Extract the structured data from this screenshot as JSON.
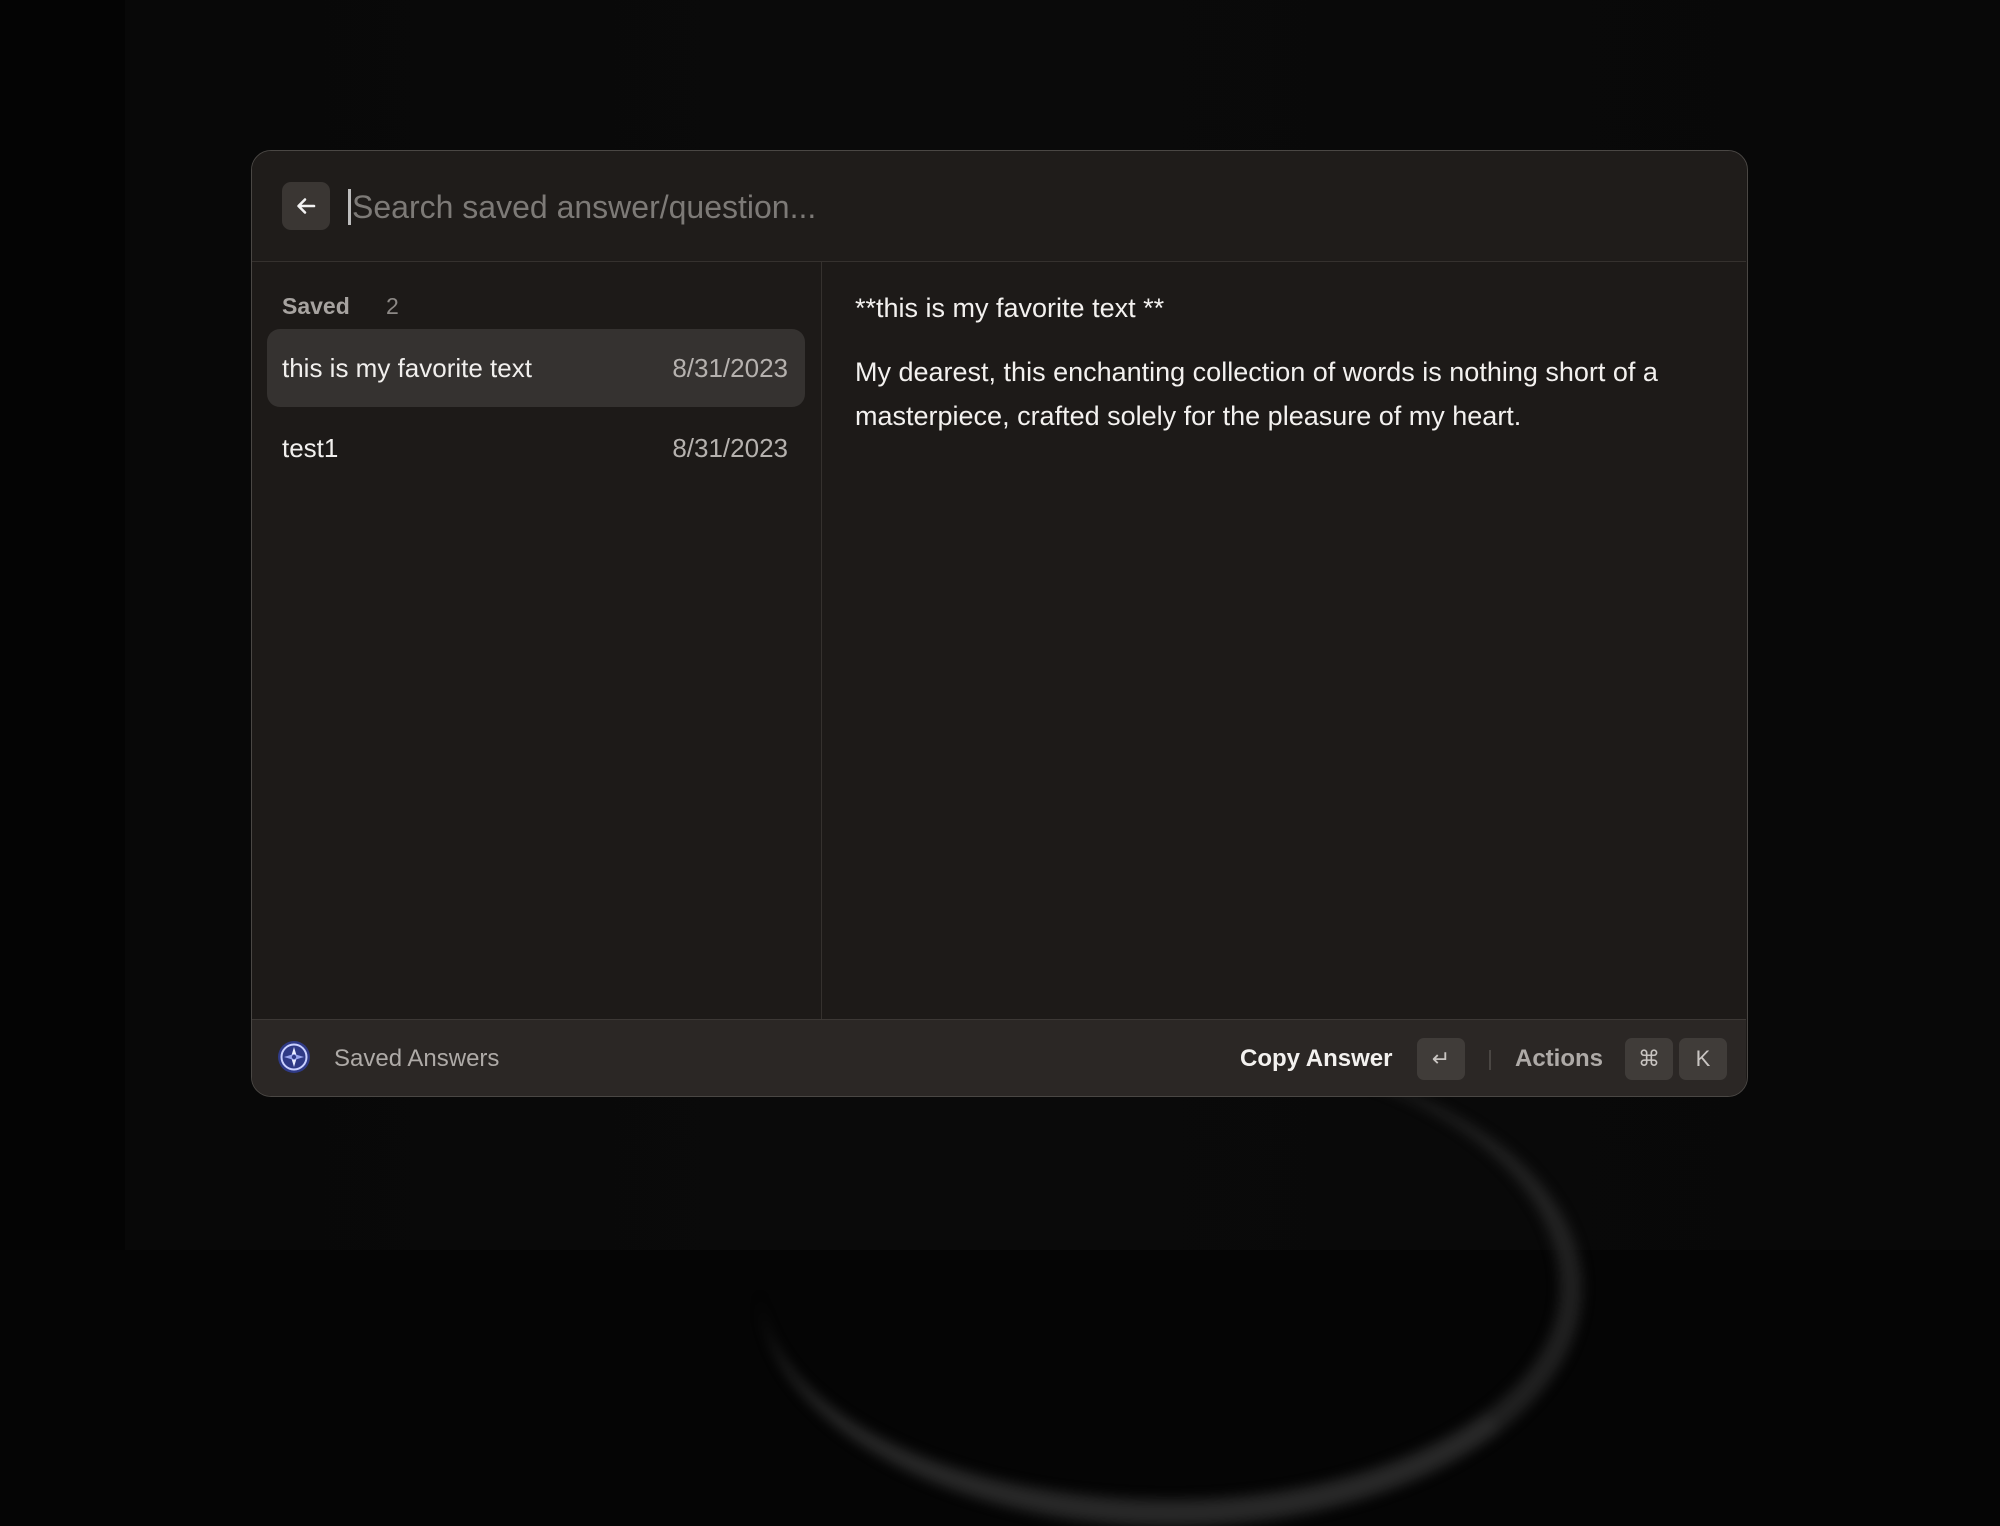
{
  "search": {
    "placeholder": "Search saved answer/question...",
    "value": ""
  },
  "sidebar": {
    "section_label": "Saved",
    "section_count": "2",
    "items": [
      {
        "title": "this is my favorite text",
        "date": "8/31/2023",
        "selected": true
      },
      {
        "title": "test1",
        "date": "8/31/2023",
        "selected": false
      }
    ]
  },
  "detail": {
    "heading": "**this is my favorite text **",
    "body": "My dearest, this enchanting collection of words is nothing short of a masterpiece, crafted solely for the pleasure of my heart."
  },
  "footer": {
    "app_icon": "compass-icon",
    "title": "Saved Answers",
    "primary_action": "Copy Answer",
    "primary_key": "↵",
    "actions_label": "Actions",
    "actions_keys": [
      "⌘",
      "K"
    ]
  },
  "colors": {
    "window_bg": "#1d1a18",
    "selected_item_bg": "#353230",
    "footer_bg": "#2b2725",
    "text_primary": "#f3f1ef",
    "text_secondary": "#aeaaa7",
    "desktop_bg": "#050505"
  }
}
